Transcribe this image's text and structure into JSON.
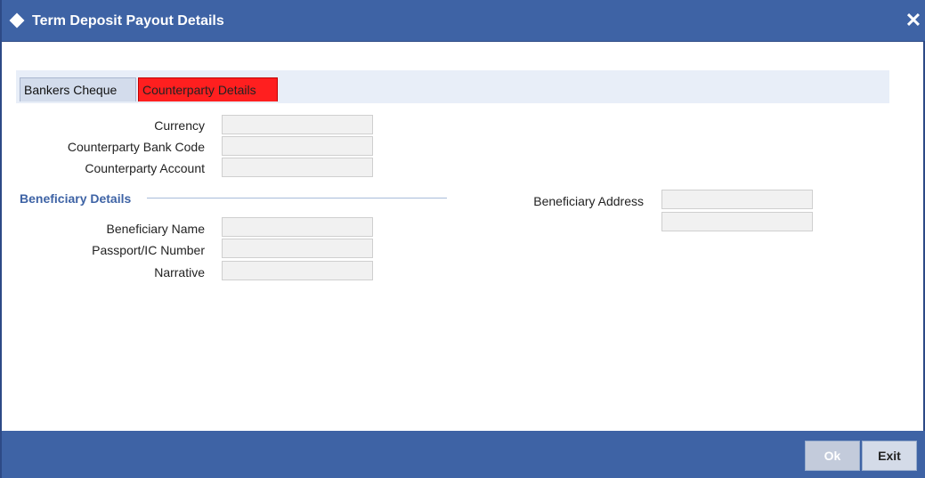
{
  "window": {
    "title": "Term Deposit Payout Details",
    "close_glyph": "✕",
    "title_icon": "diamond-icon"
  },
  "tabs": [
    {
      "label": "Bankers Cheque"
    },
    {
      "label": "Counterparty Details"
    }
  ],
  "fields": {
    "currency": {
      "label": "Currency",
      "value": ""
    },
    "counterparty_bank_code": {
      "label": "Counterparty Bank Code",
      "value": ""
    },
    "counterparty_account": {
      "label": "Counterparty Account",
      "value": ""
    }
  },
  "beneficiary": {
    "section_title": "Beneficiary Details",
    "name": {
      "label": "Beneficiary Name",
      "value": ""
    },
    "passport": {
      "label": "Passport/IC Number",
      "value": ""
    },
    "narrative": {
      "label": "Narrative",
      "value": ""
    },
    "address": {
      "label": "Beneficiary Address",
      "line1": "",
      "line2": ""
    }
  },
  "footer": {
    "ok_label": "Ok",
    "exit_label": "Exit"
  },
  "colors": {
    "titlebar": "#3e63a5",
    "active_tab": "#ff1f1f",
    "section_title": "#3e63a5"
  }
}
